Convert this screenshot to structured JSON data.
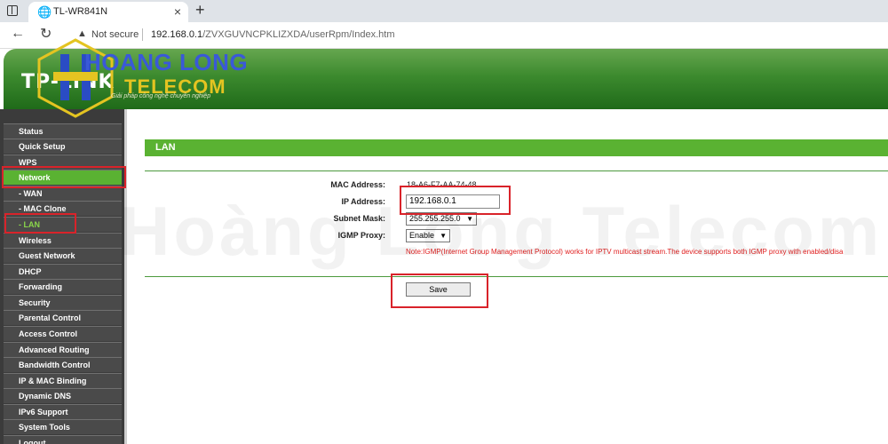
{
  "browser": {
    "tab_title": "TL-WR841N",
    "tab_icon": "globe-icon",
    "security_label": "Not secure",
    "url_host": "192.168.0.1",
    "url_path": "/ZVXGUVNCPKLIZXDA/userRpm/Index.htm"
  },
  "header": {
    "logo_text": "TP-LINK",
    "watermark_brand_line1": "HOANG LONG",
    "watermark_brand_line2": "TELECOM",
    "watermark_tagline": "Giải pháp công nghệ chuyên nghiệp"
  },
  "sidebar": {
    "items": [
      {
        "label": "Status"
      },
      {
        "label": "Quick Setup"
      },
      {
        "label": "WPS"
      },
      {
        "label": "Network",
        "state": "active"
      },
      {
        "label": "- WAN",
        "sub": true
      },
      {
        "label": "- MAC Clone",
        "sub": true
      },
      {
        "label": "- LAN",
        "sub": true,
        "state": "selected"
      },
      {
        "label": "Wireless"
      },
      {
        "label": "Guest Network"
      },
      {
        "label": "DHCP"
      },
      {
        "label": "Forwarding"
      },
      {
        "label": "Security"
      },
      {
        "label": "Parental Control"
      },
      {
        "label": "Access Control"
      },
      {
        "label": "Advanced Routing"
      },
      {
        "label": "Bandwidth Control"
      },
      {
        "label": "IP & MAC Binding"
      },
      {
        "label": "Dynamic DNS"
      },
      {
        "label": "IPv6 Support"
      },
      {
        "label": "System Tools"
      },
      {
        "label": "Logout"
      }
    ]
  },
  "main": {
    "section_title": "LAN",
    "mac_label": "MAC Address:",
    "mac_value": "18-A6-F7-AA-74-48",
    "ip_label": "IP Address:",
    "ip_value": "192.168.0.1",
    "subnet_label": "Subnet Mask:",
    "subnet_value": "255.255.255.0",
    "igmp_label": "IGMP Proxy:",
    "igmp_value": "Enable",
    "note": "Note:IGMP(Internet Group Management Protocol) works for IPTV multicast stream.The device supports both IGMP proxy with enabled/disa",
    "save_label": "Save"
  },
  "watermark_text": "Hoàng Long Telecom",
  "colors": {
    "accent_green": "#5ab232",
    "highlight_red": "#d9232a",
    "note_red": "#e01f1f"
  }
}
